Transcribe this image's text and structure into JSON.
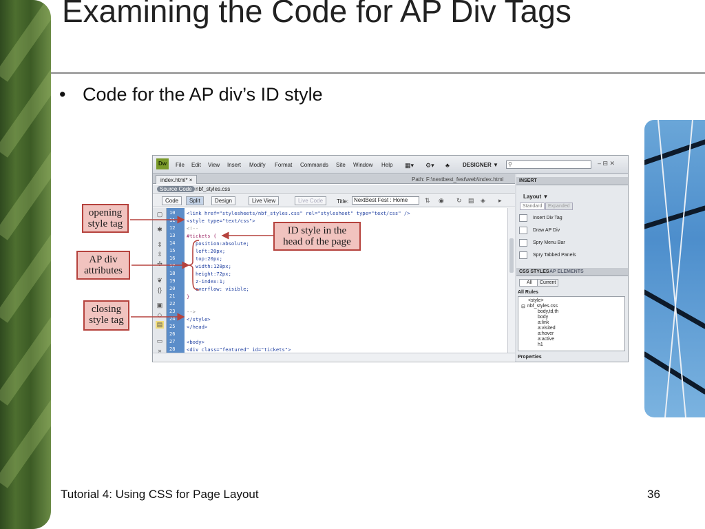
{
  "slide": {
    "title": "Examining the Code for AP Div Tags",
    "bullet": "Code for the AP div’s ID style",
    "footer_left": "Tutorial 4: Using CSS for Page Layout",
    "page_number": "36"
  },
  "app": {
    "logo": "Dw",
    "menu": [
      "File",
      "Edit",
      "View",
      "Insert",
      "Modify",
      "Format",
      "Commands",
      "Site",
      "Window",
      "Help"
    ],
    "workspace": "DESIGNER ▼",
    "window_controls": "– ⊟ ✕"
  },
  "document": {
    "tab_label": "index.html* ×",
    "path": "Path: F:\\nextbest_fest\\web\\index.html",
    "source_code_label": "Source Code",
    "related_file": "nbf_styles.css",
    "views": [
      "Code",
      "Split",
      "Design",
      "Live View",
      "Live Code"
    ],
    "title_label": "Title:",
    "title_value": "NextBest Fest : Home"
  },
  "code": {
    "line_numbers": [
      "10",
      "11",
      "12",
      "13",
      "14",
      "15",
      "16",
      "17",
      "18",
      "19",
      "20",
      "21",
      "22",
      "23",
      "24",
      "25",
      "26",
      "27",
      "28"
    ],
    "lines": [
      "<link href=\"stylesheets/nbf_styles.css\" rel=\"stylesheet\" type=\"text/css\" />",
      "<style type=\"text/css\">",
      "<!--",
      "#tickets {",
      "   position:absolute;",
      "   left:20px;",
      "   top:20px;",
      "   width:128px;",
      "   height:72px;",
      "   z-index:1;",
      "   overflow: visible;",
      "}",
      "",
      "-->",
      "</style>",
      "</head>",
      "",
      "<body>",
      "<div class=\"featured\" id=\"tickets\">"
    ]
  },
  "panels": {
    "insert": {
      "tab": "INSERT",
      "category": "Layout ▼",
      "standard_label": "Standard",
      "expanded_label": "Expanded",
      "items": [
        "Insert Div Tag",
        "Draw AP Div",
        "Spry Menu Bar",
        "Spry Tabbed Panels"
      ]
    },
    "css": {
      "tabs": [
        "CSS STYLES",
        "AP ELEMENTS"
      ],
      "all_label": "All",
      "current_label": "Current",
      "all_rules_label": "All Rules",
      "rules": [
        "<style>",
        "nbf_styles.css",
        "body,td,th",
        "body",
        "a:link",
        "a:visited",
        "a:hover",
        "a:active",
        "h1"
      ],
      "properties_label": "Properties"
    }
  },
  "callouts": {
    "opening": "opening style tag",
    "id_style": "ID style in the head of the page",
    "ap_div": "AP div attributes",
    "closing": "closing style tag"
  },
  "colors": {
    "callout_fill": "#f1c3bf",
    "callout_border": "#b5423d",
    "gutter": "#5b8dc9"
  }
}
